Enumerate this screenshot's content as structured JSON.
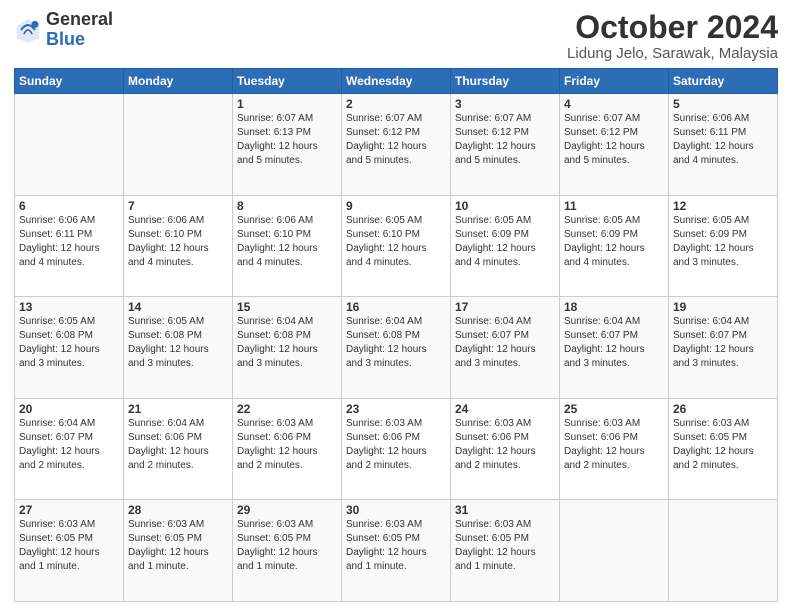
{
  "logo": {
    "line1": "General",
    "line2": "Blue"
  },
  "title": "October 2024",
  "location": "Lidung Jelo, Sarawak, Malaysia",
  "headers": [
    "Sunday",
    "Monday",
    "Tuesday",
    "Wednesday",
    "Thursday",
    "Friday",
    "Saturday"
  ],
  "weeks": [
    [
      {
        "day": "",
        "info": ""
      },
      {
        "day": "",
        "info": ""
      },
      {
        "day": "1",
        "info": "Sunrise: 6:07 AM\nSunset: 6:13 PM\nDaylight: 12 hours\nand 5 minutes."
      },
      {
        "day": "2",
        "info": "Sunrise: 6:07 AM\nSunset: 6:12 PM\nDaylight: 12 hours\nand 5 minutes."
      },
      {
        "day": "3",
        "info": "Sunrise: 6:07 AM\nSunset: 6:12 PM\nDaylight: 12 hours\nand 5 minutes."
      },
      {
        "day": "4",
        "info": "Sunrise: 6:07 AM\nSunset: 6:12 PM\nDaylight: 12 hours\nand 5 minutes."
      },
      {
        "day": "5",
        "info": "Sunrise: 6:06 AM\nSunset: 6:11 PM\nDaylight: 12 hours\nand 4 minutes."
      }
    ],
    [
      {
        "day": "6",
        "info": "Sunrise: 6:06 AM\nSunset: 6:11 PM\nDaylight: 12 hours\nand 4 minutes."
      },
      {
        "day": "7",
        "info": "Sunrise: 6:06 AM\nSunset: 6:10 PM\nDaylight: 12 hours\nand 4 minutes."
      },
      {
        "day": "8",
        "info": "Sunrise: 6:06 AM\nSunset: 6:10 PM\nDaylight: 12 hours\nand 4 minutes."
      },
      {
        "day": "9",
        "info": "Sunrise: 6:05 AM\nSunset: 6:10 PM\nDaylight: 12 hours\nand 4 minutes."
      },
      {
        "day": "10",
        "info": "Sunrise: 6:05 AM\nSunset: 6:09 PM\nDaylight: 12 hours\nand 4 minutes."
      },
      {
        "day": "11",
        "info": "Sunrise: 6:05 AM\nSunset: 6:09 PM\nDaylight: 12 hours\nand 4 minutes."
      },
      {
        "day": "12",
        "info": "Sunrise: 6:05 AM\nSunset: 6:09 PM\nDaylight: 12 hours\nand 3 minutes."
      }
    ],
    [
      {
        "day": "13",
        "info": "Sunrise: 6:05 AM\nSunset: 6:08 PM\nDaylight: 12 hours\nand 3 minutes."
      },
      {
        "day": "14",
        "info": "Sunrise: 6:05 AM\nSunset: 6:08 PM\nDaylight: 12 hours\nand 3 minutes."
      },
      {
        "day": "15",
        "info": "Sunrise: 6:04 AM\nSunset: 6:08 PM\nDaylight: 12 hours\nand 3 minutes."
      },
      {
        "day": "16",
        "info": "Sunrise: 6:04 AM\nSunset: 6:08 PM\nDaylight: 12 hours\nand 3 minutes."
      },
      {
        "day": "17",
        "info": "Sunrise: 6:04 AM\nSunset: 6:07 PM\nDaylight: 12 hours\nand 3 minutes."
      },
      {
        "day": "18",
        "info": "Sunrise: 6:04 AM\nSunset: 6:07 PM\nDaylight: 12 hours\nand 3 minutes."
      },
      {
        "day": "19",
        "info": "Sunrise: 6:04 AM\nSunset: 6:07 PM\nDaylight: 12 hours\nand 3 minutes."
      }
    ],
    [
      {
        "day": "20",
        "info": "Sunrise: 6:04 AM\nSunset: 6:07 PM\nDaylight: 12 hours\nand 2 minutes."
      },
      {
        "day": "21",
        "info": "Sunrise: 6:04 AM\nSunset: 6:06 PM\nDaylight: 12 hours\nand 2 minutes."
      },
      {
        "day": "22",
        "info": "Sunrise: 6:03 AM\nSunset: 6:06 PM\nDaylight: 12 hours\nand 2 minutes."
      },
      {
        "day": "23",
        "info": "Sunrise: 6:03 AM\nSunset: 6:06 PM\nDaylight: 12 hours\nand 2 minutes."
      },
      {
        "day": "24",
        "info": "Sunrise: 6:03 AM\nSunset: 6:06 PM\nDaylight: 12 hours\nand 2 minutes."
      },
      {
        "day": "25",
        "info": "Sunrise: 6:03 AM\nSunset: 6:06 PM\nDaylight: 12 hours\nand 2 minutes."
      },
      {
        "day": "26",
        "info": "Sunrise: 6:03 AM\nSunset: 6:05 PM\nDaylight: 12 hours\nand 2 minutes."
      }
    ],
    [
      {
        "day": "27",
        "info": "Sunrise: 6:03 AM\nSunset: 6:05 PM\nDaylight: 12 hours\nand 1 minute."
      },
      {
        "day": "28",
        "info": "Sunrise: 6:03 AM\nSunset: 6:05 PM\nDaylight: 12 hours\nand 1 minute."
      },
      {
        "day": "29",
        "info": "Sunrise: 6:03 AM\nSunset: 6:05 PM\nDaylight: 12 hours\nand 1 minute."
      },
      {
        "day": "30",
        "info": "Sunrise: 6:03 AM\nSunset: 6:05 PM\nDaylight: 12 hours\nand 1 minute."
      },
      {
        "day": "31",
        "info": "Sunrise: 6:03 AM\nSunset: 6:05 PM\nDaylight: 12 hours\nand 1 minute."
      },
      {
        "day": "",
        "info": ""
      },
      {
        "day": "",
        "info": ""
      }
    ]
  ]
}
